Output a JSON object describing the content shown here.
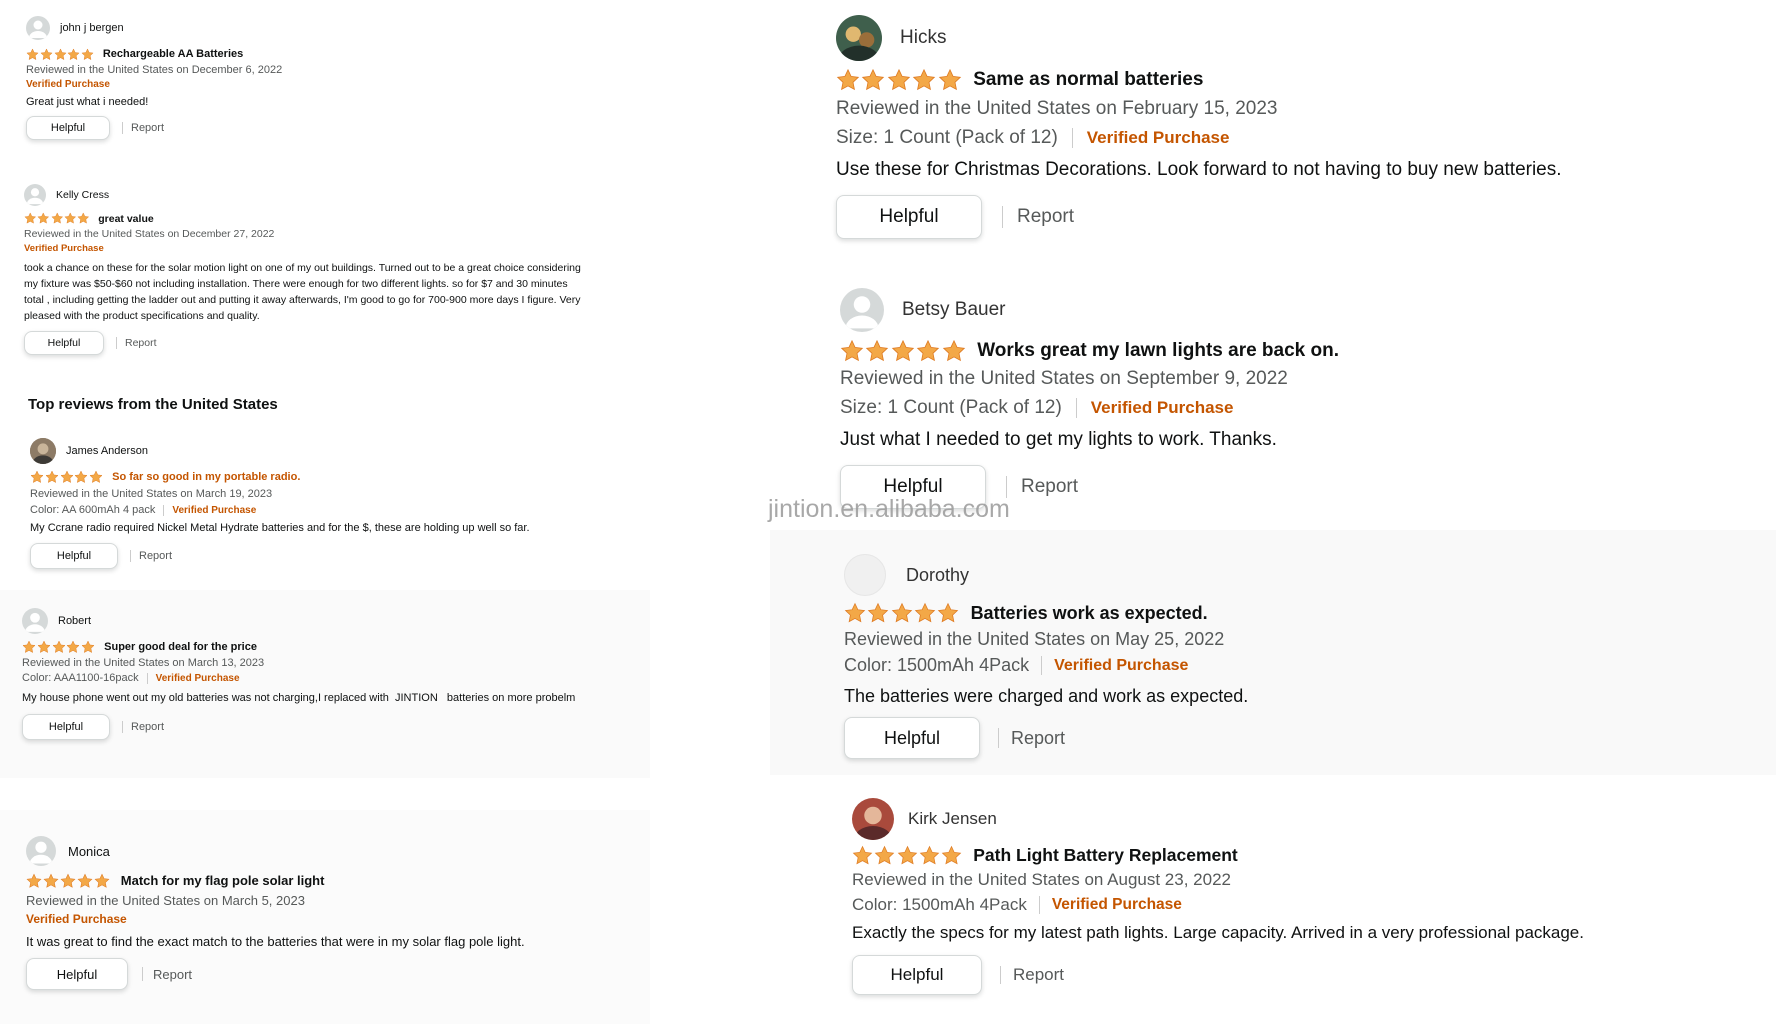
{
  "colors": {
    "star": "#f3a847",
    "verified": "#c45500",
    "meta": "#565959"
  },
  "left": {
    "reviews": [
      {
        "name": "john j bergen",
        "avatar": "default-user-icon",
        "title": "Rechargeable AA Batteries",
        "stars": 5,
        "date": "Reviewed in the United States on December 6, 2022",
        "variant": "",
        "verified": "Verified Purchase",
        "body": "Great just what i needed!",
        "helpful": "Helpful",
        "report": "Report"
      },
      {
        "name": "Kelly Cress",
        "avatar": "default-user-icon",
        "title": "great value",
        "stars": 5,
        "date": "Reviewed in the United States on December 27, 2022",
        "variant": "",
        "verified": "Verified Purchase",
        "body": "took a chance on these for the solar motion light on one of my out buildings. Turned out to be a great choice considering my fixture was $50-$60 not including installation. There were enough for two different lights. so for $7 and 30 minutes total , including getting the ladder out and putting it away afterwards, I'm good to go for 700-900 more days I figure. Very pleased with the product specifications and quality.",
        "helpful": "Helpful",
        "report": "Report"
      }
    ],
    "section_heading": "Top reviews from the United States",
    "top_reviews": [
      {
        "name": "James Anderson",
        "avatar": "photo-avatar",
        "title": "So far so good in my portable radio.",
        "stars": 5,
        "date": "Reviewed in the United States on March 19, 2023",
        "variant": "Color: AA 600mAh 4 pack",
        "verified": "Verified Purchase",
        "body": "My Ccrane radio required Nickel Metal Hydrate batteries and for the $, these are holding up well so far.",
        "helpful": "Helpful",
        "report": "Report"
      },
      {
        "name": "Robert",
        "avatar": "default-user-icon",
        "title": "Super good deal for the price",
        "stars": 5,
        "date": "Reviewed in the United States on March 13, 2023",
        "variant": "Color: AAA1100-16pack",
        "verified": "Verified Purchase",
        "body": "My house phone went out my old batteries was not charging,I replaced with  JINTION   batteries on more probelm",
        "helpful": "Helpful",
        "report": "Report"
      },
      {
        "name": "Monica",
        "avatar": "default-user-icon",
        "title": "Match for my flag pole solar light",
        "stars": 5,
        "date": "Reviewed in the United States on March 5, 2023",
        "variant": "",
        "verified": "Verified Purchase",
        "body": "It was great to find the exact match to the batteries that were in my solar flag pole light.",
        "helpful": "Helpful",
        "report": "Report"
      }
    ]
  },
  "right": {
    "reviews": [
      {
        "name": "Hicks",
        "avatar": "photo-avatar",
        "title": "Same as normal batteries",
        "stars": 5,
        "date": "Reviewed in the United States on February 15, 2023",
        "variant": "Size: 1 Count (Pack of 12)",
        "verified": "Verified Purchase",
        "body": "Use these for Christmas Decorations. Look forward to not having to buy new batteries.",
        "helpful": "Helpful",
        "report": "Report"
      },
      {
        "name": "Betsy Bauer",
        "avatar": "default-user-icon",
        "title": "Works great my lawn lights are back on.",
        "stars": 5,
        "date": "Reviewed in the United States on September 9, 2022",
        "variant": "Size: 1 Count (Pack of 12)",
        "verified": "Verified Purchase",
        "body": "Just what I needed to get my lights to work. Thanks.",
        "helpful": "Helpful",
        "report": "Report"
      },
      {
        "name": "Dorothy",
        "avatar": "blank-avatar",
        "title": "Batteries work as expected.",
        "stars": 5,
        "date": "Reviewed in the United States on May 25, 2022",
        "variant": "Color: 1500mAh 4Pack",
        "verified": "Verified Purchase",
        "body": "The batteries were charged and work as expected.",
        "helpful": "Helpful",
        "report": "Report"
      },
      {
        "name": "Kirk Jensen",
        "avatar": "photo-avatar",
        "title": "Path Light Battery Replacement",
        "stars": 5,
        "date": "Reviewed in the United States on August 23, 2022",
        "variant": "Color: 1500mAh 4Pack",
        "verified": "Verified Purchase",
        "body": "Exactly the specs for my latest path lights. Large capacity. Arrived in a very professional package.",
        "helpful": "Helpful",
        "report": "Report"
      }
    ]
  },
  "watermark": "jintion.en.alibaba.com"
}
